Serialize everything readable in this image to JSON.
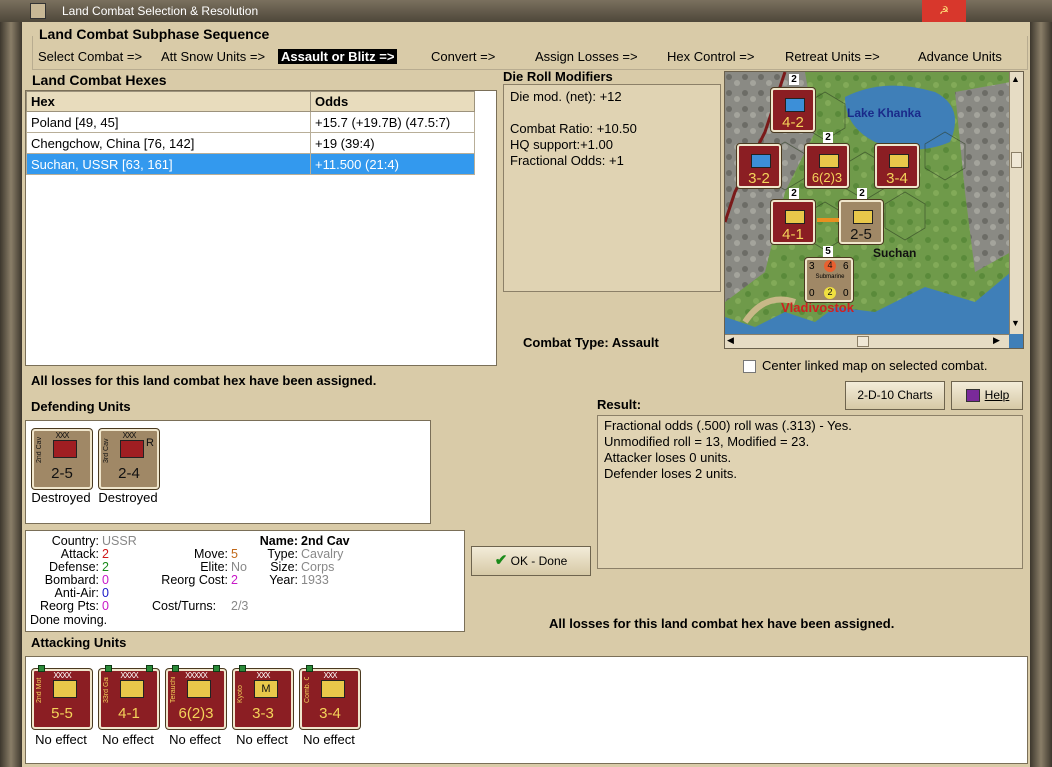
{
  "window": {
    "title": "Land Combat Selection & Resolution",
    "close_glyph": "☭"
  },
  "subphase": {
    "heading": "Land Combat Subphase Sequence",
    "steps": [
      "Select Combat =>",
      "Att Snow Units =>",
      "Assault or Blitz =>",
      "Convert =>",
      "Assign Losses =>",
      "Hex Control =>",
      "Retreat Units =>",
      "Advance Units"
    ],
    "active_index": 2
  },
  "hexes": {
    "heading": "Land Combat Hexes",
    "columns": [
      "Hex",
      "Odds"
    ],
    "rows": [
      {
        "hex": "Poland [49, 45]",
        "odds": "+15.7 (+19.7B) (47.5:7)"
      },
      {
        "hex": "Chengchow, China [76, 142]",
        "odds": "+19 (39:4)"
      },
      {
        "hex": "Suchan, USSR [63, 161]",
        "odds": "+11.500 (21:4)"
      }
    ],
    "selected_index": 2
  },
  "die_roll": {
    "heading": "Die Roll Modifiers",
    "lines": [
      "Die mod. (net): +12",
      "",
      "Combat Ratio: +10.50",
      "HQ support:+1.00",
      "Fractional Odds: +1"
    ]
  },
  "combat_type": {
    "label": "Combat Type:",
    "value": "Assault"
  },
  "map": {
    "lake_label": "Lake Khanka",
    "city1": "Suchan",
    "city2": "Vladivostok",
    "stacks": [
      {
        "value": "4-2",
        "count": "2"
      },
      {
        "value": "3-2",
        "count": ""
      },
      {
        "value": "6(2)3",
        "count": "2"
      },
      {
        "value": "3-4",
        "count": ""
      },
      {
        "value": "4-1",
        "count": "2"
      },
      {
        "value": "2-5",
        "count": "2"
      },
      {
        "value": "Submarine",
        "count": "5"
      }
    ],
    "sub_numbers": [
      "3",
      "4",
      "6",
      "0",
      "2",
      "0"
    ]
  },
  "center_map": {
    "label": "Center linked map on selected combat.",
    "checked": false
  },
  "buttons": {
    "charts": "2-D-10 Charts",
    "help": "Help",
    "ok": "OK - Done"
  },
  "losses_msg": "All losses for this land combat hex have been assigned.",
  "defending": {
    "heading": "Defending Units",
    "units": [
      {
        "side": "2nd Cav",
        "size": "XXX",
        "value": "2-5",
        "status": "Destroyed",
        "reorg": ""
      },
      {
        "side": "3rd Cav",
        "size": "XXX",
        "value": "2-4",
        "status": "Destroyed",
        "reorg": "R"
      }
    ]
  },
  "result": {
    "heading": "Result:",
    "lines": [
      "Fractional odds (.500) roll was (.313)  - Yes.",
      "Unmodified roll = 13, Modified = 23.",
      "Attacker loses 0 units.",
      "Defender loses 2 units."
    ]
  },
  "unit_info": {
    "country_label": "Country:",
    "country": "USSR",
    "attack_label": "Attack:",
    "attack": "2",
    "defense_label": "Defense:",
    "defense": "2",
    "bombard_label": "Bombard:",
    "bombard": "0",
    "antiair_label": "Anti-Air:",
    "antiair": "0",
    "reorgpts_label": "Reorg Pts:",
    "reorgpts": "0",
    "done": "Done moving.",
    "name_label": "Name:",
    "name": "2nd Cav",
    "move_label": "Move:",
    "move": "5",
    "type_label": "Type:",
    "type": "Cavalry",
    "elite_label": "Elite:",
    "elite": "No",
    "size_label": "Size:",
    "size": "Corps",
    "reorgcost_label": "Reorg Cost:",
    "reorgcost": "2",
    "year_label": "Year:",
    "year": "1933",
    "costturns_label": "Cost/Turns:",
    "costturns": "2/3"
  },
  "attacking": {
    "heading": "Attacking Units",
    "units": [
      {
        "side": "2nd Mot",
        "size": "XXXX",
        "value": "5-5",
        "status": "No effect",
        "glyph": "",
        "blue": false
      },
      {
        "side": "33rd Garr",
        "size": "XXXX",
        "value": "4-1",
        "status": "No effect",
        "glyph": "",
        "blue": false
      },
      {
        "side": "Terauchi",
        "size": "XXXXX",
        "value": "6(2)3",
        "status": "No effect",
        "glyph": "",
        "blue": false
      },
      {
        "side": "Kyoto",
        "size": "XXX",
        "value": "3-3",
        "status": "No effect",
        "glyph": "M",
        "blue": false
      },
      {
        "side": "Comb. Car",
        "size": "XXX",
        "value": "3-4",
        "status": "No effect",
        "glyph": "",
        "blue": false
      }
    ]
  },
  "colors": {
    "tan": "#d9cba8",
    "selected": "#3399ee",
    "unit_red": "#8b1e23",
    "unit_brown": "#a08866"
  }
}
